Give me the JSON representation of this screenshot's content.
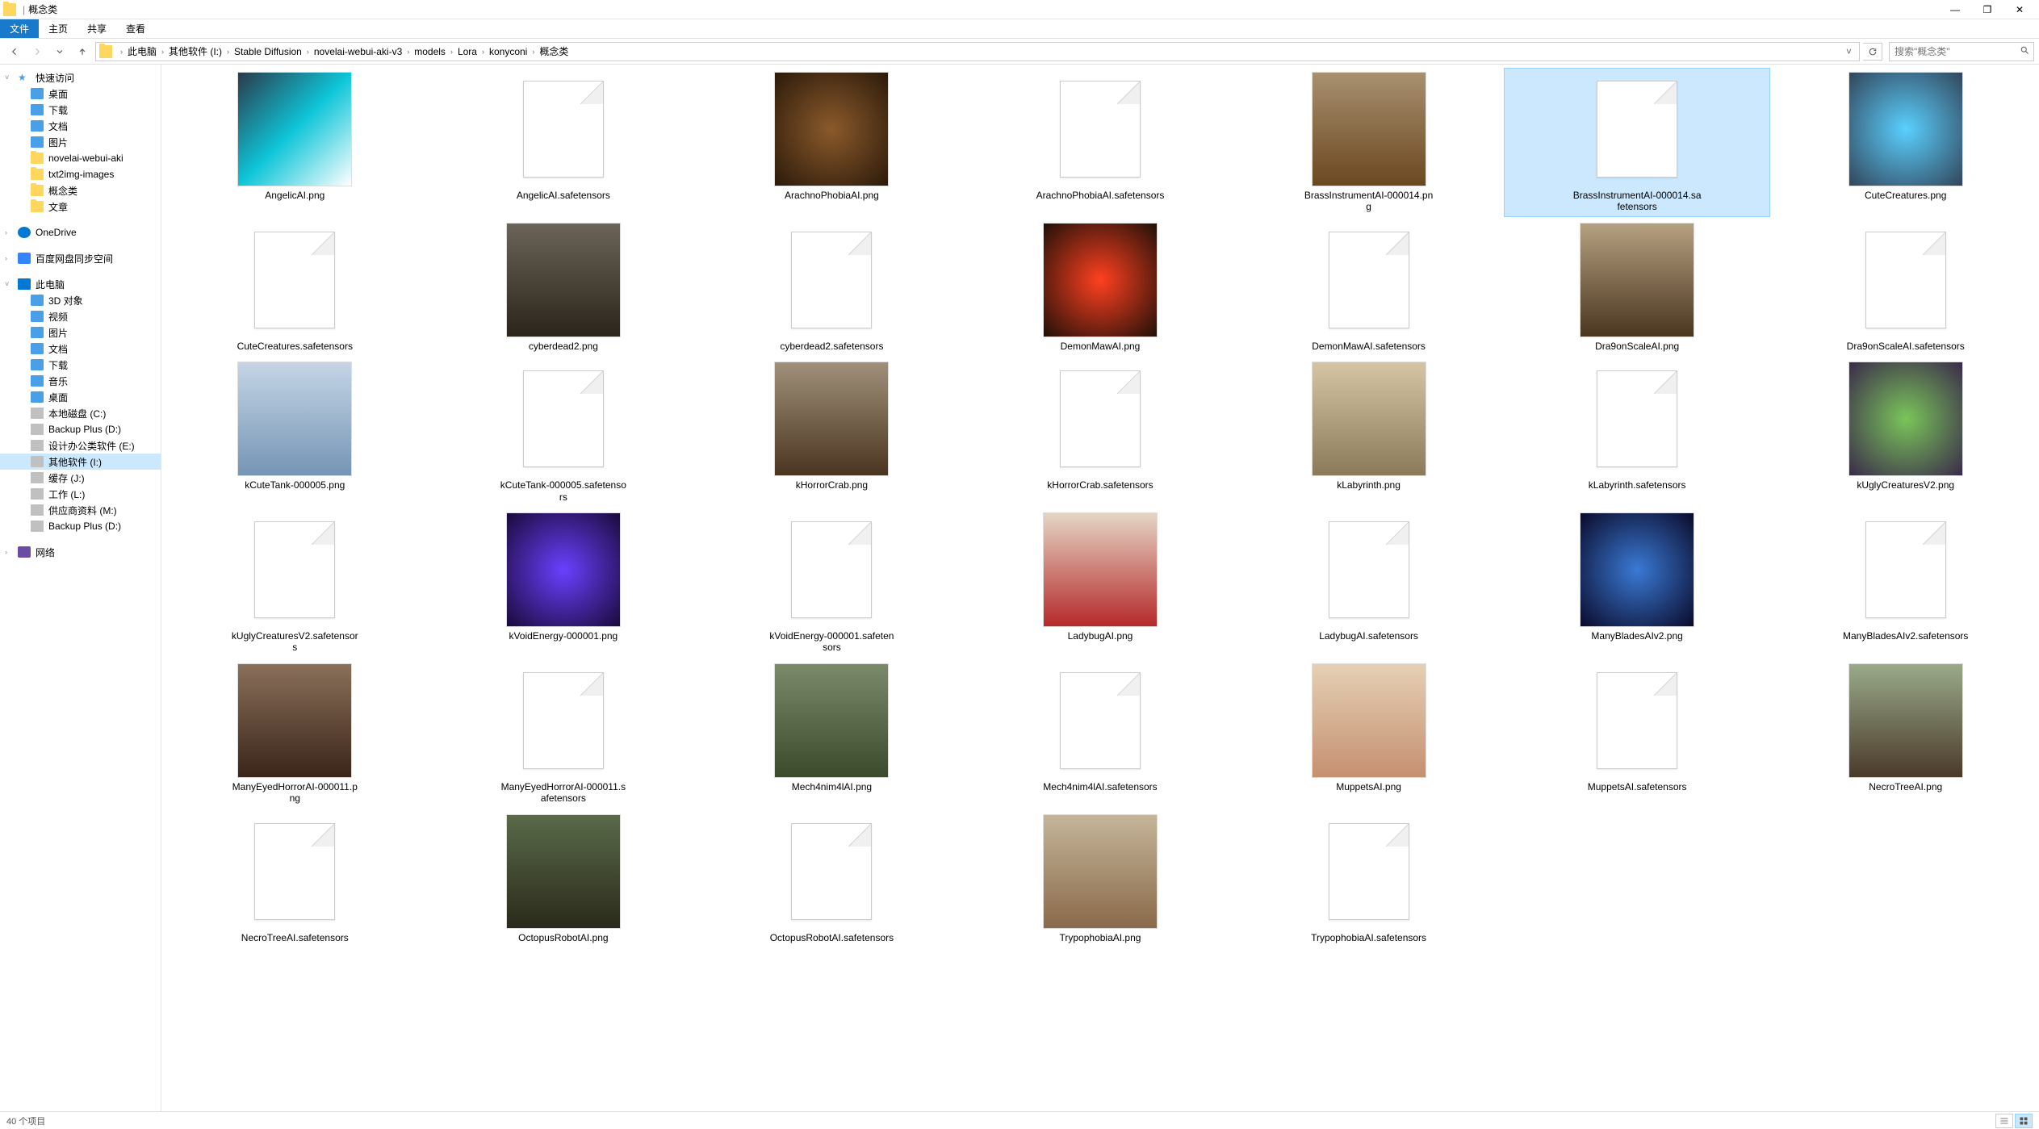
{
  "window": {
    "title": "概念类",
    "controls": {
      "min": "—",
      "max": "❐",
      "close": "✕"
    }
  },
  "ribbon": {
    "file": "文件",
    "tabs": [
      "主页",
      "共享",
      "查看"
    ]
  },
  "nav": {
    "breadcrumb": [
      "此电脑",
      "其他软件 (I:)",
      "Stable Diffusion",
      "novelai-webui-aki-v3",
      "models",
      "Lora",
      "konyconi",
      "概念类"
    ],
    "search_placeholder": "搜索\"概念类\""
  },
  "sidebar": {
    "quick_access_label": "快速访问",
    "quick_access_items": [
      {
        "label": "桌面",
        "icon": "desktop"
      },
      {
        "label": "下载",
        "icon": "download"
      },
      {
        "label": "文档",
        "icon": "docs"
      },
      {
        "label": "图片",
        "icon": "pics"
      },
      {
        "label": "novelai-webui-aki",
        "icon": "folder"
      },
      {
        "label": "txt2img-images",
        "icon": "folder"
      },
      {
        "label": "概念类",
        "icon": "folder"
      },
      {
        "label": "文章",
        "icon": "folder"
      }
    ],
    "onedrive": "OneDrive",
    "baidu": "百度网盘同步空间",
    "thispc_label": "此电脑",
    "thispc_items": [
      {
        "label": "3D 对象",
        "icon": "objects3d"
      },
      {
        "label": "视频",
        "icon": "video"
      },
      {
        "label": "图片",
        "icon": "pics"
      },
      {
        "label": "文档",
        "icon": "docs"
      },
      {
        "label": "下载",
        "icon": "download"
      },
      {
        "label": "音乐",
        "icon": "music"
      },
      {
        "label": "桌面",
        "icon": "desktop"
      },
      {
        "label": "本地磁盘 (C:)",
        "icon": "drive"
      },
      {
        "label": "Backup Plus (D:)",
        "icon": "drive"
      },
      {
        "label": "设计办公类软件 (E:)",
        "icon": "drive"
      },
      {
        "label": "其他软件 (I:)",
        "icon": "drive",
        "selected": true
      },
      {
        "label": "缓存 (J:)",
        "icon": "drive"
      },
      {
        "label": "工作 (L:)",
        "icon": "drive"
      },
      {
        "label": "供应商资料 (M:)",
        "icon": "drive"
      },
      {
        "label": "Backup Plus (D:)",
        "icon": "drive"
      }
    ],
    "network": "网络"
  },
  "files": [
    {
      "name": "AngelicAI.png",
      "type": "image",
      "th": "th0"
    },
    {
      "name": "AngelicAI.safetensors",
      "type": "file"
    },
    {
      "name": "ArachnoPhobiaAI.png",
      "type": "image",
      "th": "th2"
    },
    {
      "name": "ArachnoPhobiaAI.safetensors",
      "type": "file"
    },
    {
      "name": "BrassInstrumentAI-000014.png",
      "type": "image",
      "th": "th4"
    },
    {
      "name": "BrassInstrumentAI-000014.safetensors",
      "type": "file",
      "selected": true
    },
    {
      "name": "CuteCreatures.png",
      "type": "image",
      "th": "th6"
    },
    {
      "name": "CuteCreatures.safetensors",
      "type": "file"
    },
    {
      "name": "cyberdead2.png",
      "type": "image",
      "th": "th8"
    },
    {
      "name": "cyberdead2.safetensors",
      "type": "file"
    },
    {
      "name": "DemonMawAI.png",
      "type": "image",
      "th": "th10"
    },
    {
      "name": "DemonMawAI.safetensors",
      "type": "file"
    },
    {
      "name": "Dra9onScaleAI.png",
      "type": "image",
      "th": "th12"
    },
    {
      "name": "Dra9onScaleAI.safetensors",
      "type": "file"
    },
    {
      "name": "kCuteTank-000005.png",
      "type": "image",
      "th": "th14"
    },
    {
      "name": "kCuteTank-000005.safetensors",
      "type": "file"
    },
    {
      "name": "kHorrorCrab.png",
      "type": "image",
      "th": "th16"
    },
    {
      "name": "kHorrorCrab.safetensors",
      "type": "file"
    },
    {
      "name": "kLabyrinth.png",
      "type": "image",
      "th": "th18"
    },
    {
      "name": "kLabyrinth.safetensors",
      "type": "file"
    },
    {
      "name": "kUglyCreaturesV2.png",
      "type": "image",
      "th": "th20"
    },
    {
      "name": "kUglyCreaturesV2.safetensors",
      "type": "file"
    },
    {
      "name": "kVoidEnergy-000001.png",
      "type": "image",
      "th": "th22"
    },
    {
      "name": "kVoidEnergy-000001.safetensors",
      "type": "file"
    },
    {
      "name": "LadybugAI.png",
      "type": "image",
      "th": "th24"
    },
    {
      "name": "LadybugAI.safetensors",
      "type": "file"
    },
    {
      "name": "ManyBladesAIv2.png",
      "type": "image",
      "th": "th26"
    },
    {
      "name": "ManyBladesAIv2.safetensors",
      "type": "file"
    },
    {
      "name": "ManyEyedHorrorAI-000011.png",
      "type": "image",
      "th": "th28"
    },
    {
      "name": "ManyEyedHorrorAI-000011.safetensors",
      "type": "file"
    },
    {
      "name": "Mech4nim4lAI.png",
      "type": "image",
      "th": "th30"
    },
    {
      "name": "Mech4nim4lAI.safetensors",
      "type": "file"
    },
    {
      "name": "MuppetsAI.png",
      "type": "image",
      "th": "th32"
    },
    {
      "name": "MuppetsAI.safetensors",
      "type": "file"
    },
    {
      "name": "NecroTreeAI.png",
      "type": "image",
      "th": "th34"
    },
    {
      "name": "NecroTreeAI.safetensors",
      "type": "file"
    },
    {
      "name": "OctopusRobotAI.png",
      "type": "image",
      "th": "th36"
    },
    {
      "name": "OctopusRobotAI.safetensors",
      "type": "file"
    },
    {
      "name": "TrypophobiaAI.png",
      "type": "image",
      "th": "th38"
    },
    {
      "name": "TrypophobiaAI.safetensors",
      "type": "file"
    }
  ],
  "statusbar": {
    "count": "40 个项目"
  }
}
